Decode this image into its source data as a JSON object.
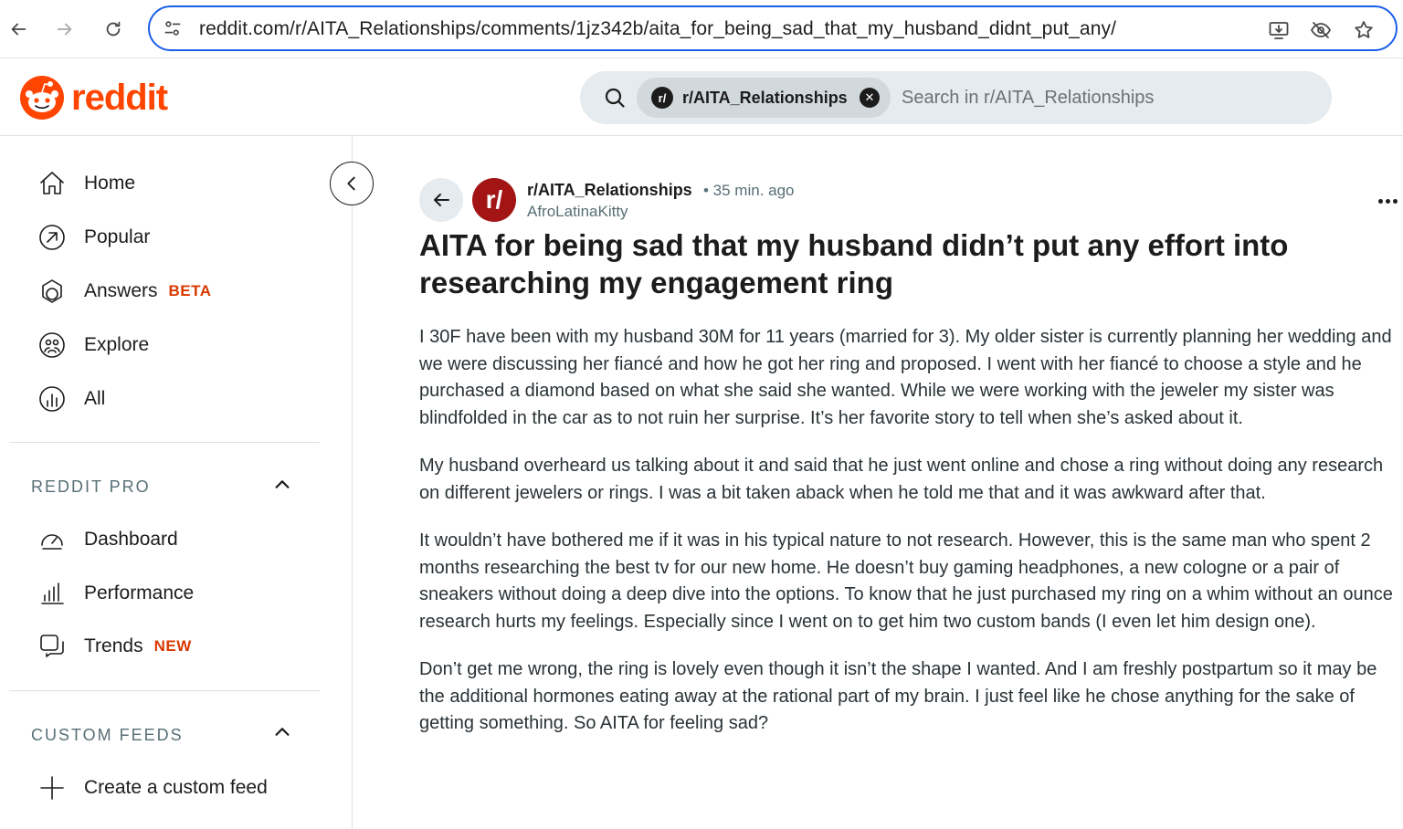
{
  "browser": {
    "url": "reddit.com/r/AITA_Relationships/comments/1jz342b/aita_for_being_sad_that_my_husband_didnt_put_any/"
  },
  "header": {
    "logo_text": "reddit",
    "search": {
      "community_chip": "r/AITA_Relationships",
      "chip_avatar": "r/",
      "placeholder": "Search in r/AITA_Relationships"
    }
  },
  "sidebar": {
    "nav": [
      {
        "label": "Home",
        "icon": "home-icon"
      },
      {
        "label": "Popular",
        "icon": "popular-arrow-icon"
      },
      {
        "label": "Answers",
        "tag": "BETA",
        "icon": "answers-icon"
      },
      {
        "label": "Explore",
        "icon": "explore-icon"
      },
      {
        "label": "All",
        "icon": "all-chart-icon"
      }
    ],
    "reddit_pro": {
      "heading": "REDDIT PRO",
      "items": [
        {
          "label": "Dashboard",
          "icon": "gauge-icon"
        },
        {
          "label": "Performance",
          "icon": "bar-chart-icon"
        },
        {
          "label": "Trends",
          "tag": "NEW",
          "icon": "trends-icon"
        }
      ]
    },
    "custom_feeds": {
      "heading": "CUSTOM FEEDS",
      "create_label": "Create a custom feed"
    }
  },
  "post": {
    "subreddit": "r/AITA_Relationships",
    "subreddit_avatar": "r/",
    "time": "• 35 min. ago",
    "author": "AfroLatinaKitty",
    "title": "AITA for being sad that my husband didn’t put any effort into researching my engagement ring",
    "paragraphs": [
      "I 30F have been with my husband 30M for 11 years (married for 3). My older sister is currently planning her wedding and we were discussing her fiancé and how he got her ring and proposed. I went with her fiancé to choose a style and he purchased a diamond based on what she said she wanted. While we were working with the jeweler my sister was blindfolded in the car as to not ruin her surprise. It’s her favorite story to tell when she’s asked about it.",
      "My husband overheard us talking about it and said that he just went online and chose a ring without doing any research on different jewelers or rings. I was a bit taken aback when he told me that and it was awkward after that.",
      "It wouldn’t have bothered me if it was in his typical nature to not research. However, this is the same man who spent 2 months researching the best tv for our new home. He doesn’t buy gaming headphones, a new cologne or a pair of sneakers without doing a deep dive into the options. To know that he just purchased my ring on a whim without an ounce research hurts my feelings. Especially since I went on to get him two custom bands (I even let him design one).",
      "Don’t get me wrong, the ring is lovely even though it isn’t the shape I wanted. And I am freshly postpartum so it may be the additional hormones eating away at the rational part of my brain. I just feel like he chose anything for the sake of getting something. So AITA for feeling sad?"
    ]
  },
  "colors": {
    "reddit_orange": "#ff4500",
    "tag_red": "#d93900",
    "omnibox_focus": "#1a5ee8",
    "subreddit_avatar_bg": "#a31515"
  }
}
